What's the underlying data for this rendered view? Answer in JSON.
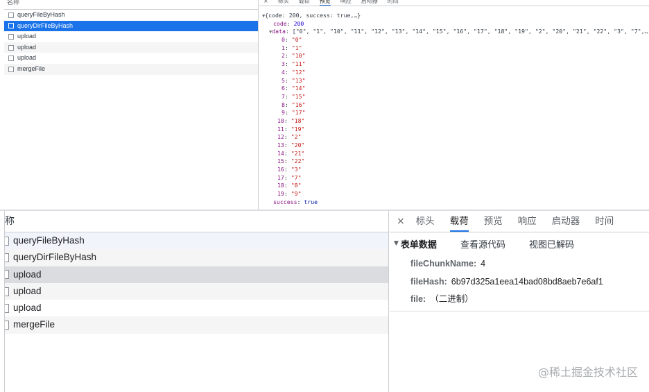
{
  "top": {
    "list_header": "名称",
    "requests": [
      {
        "name": "queryFileByHash",
        "selected": false
      },
      {
        "name": "queryDirFileByHash",
        "selected": true
      },
      {
        "name": "upload",
        "selected": false
      },
      {
        "name": "upload",
        "selected": false
      },
      {
        "name": "upload",
        "selected": false
      },
      {
        "name": "mergeFile",
        "selected": false
      }
    ],
    "tabs": [
      "×",
      "标头",
      "载荷",
      "预览",
      "响应",
      "启动器",
      "时间"
    ],
    "active_tab_index": 3,
    "preview": {
      "summary": "{code: 200, success: true,…}",
      "code_key": "code",
      "code_value": "200",
      "data_key": "data",
      "data_summary": "[\"0\", \"1\", \"10\", \"11\", \"12\", \"13\", \"14\", \"15\", \"16\", \"17\", \"18\", \"19\", \"2\", \"20\", \"21\", \"22\", \"3\", \"7\",…]",
      "data_items": [
        {
          "i": "0",
          "v": "\"0\""
        },
        {
          "i": "1",
          "v": "\"1\""
        },
        {
          "i": "2",
          "v": "\"10\""
        },
        {
          "i": "3",
          "v": "\"11\""
        },
        {
          "i": "4",
          "v": "\"12\""
        },
        {
          "i": "5",
          "v": "\"13\""
        },
        {
          "i": "6",
          "v": "\"14\""
        },
        {
          "i": "7",
          "v": "\"15\""
        },
        {
          "i": "8",
          "v": "\"16\""
        },
        {
          "i": "9",
          "v": "\"17\""
        },
        {
          "i": "10",
          "v": "\"18\""
        },
        {
          "i": "11",
          "v": "\"19\""
        },
        {
          "i": "12",
          "v": "\"2\""
        },
        {
          "i": "13",
          "v": "\"20\""
        },
        {
          "i": "14",
          "v": "\"21\""
        },
        {
          "i": "15",
          "v": "\"22\""
        },
        {
          "i": "16",
          "v": "\"3\""
        },
        {
          "i": "17",
          "v": "\"7\""
        },
        {
          "i": "18",
          "v": "\"8\""
        },
        {
          "i": "19",
          "v": "\"9\""
        }
      ],
      "success_key": "success",
      "success_value": "true"
    }
  },
  "bottom": {
    "list_header": "称",
    "requests": [
      {
        "name": "queryFileByHash"
      },
      {
        "name": "queryDirFileByHash"
      },
      {
        "name": "upload"
      },
      {
        "name": "upload"
      },
      {
        "name": "upload"
      },
      {
        "name": "mergeFile"
      }
    ],
    "selected_index": 2,
    "close_label": "×",
    "tabs": [
      "标头",
      "载荷",
      "预览",
      "响应",
      "启动器",
      "时间"
    ],
    "active_tab_index": 1,
    "form": {
      "title": "表单数据",
      "view_source": "查看源代码",
      "view_decoded": "视图已解码",
      "fields": [
        {
          "key": "fileChunkName:",
          "value": "4"
        },
        {
          "key": "fileHash:",
          "value": "6b97d325a1eea14bad08bd8aeb7e6af1"
        },
        {
          "key": "file:",
          "value": "（二进制）"
        }
      ]
    }
  },
  "watermark": "@稀土掘金技术社区",
  "colors": {
    "selection_blue": "#1a73e8",
    "json_key": "#881280",
    "json_string": "#c41a16",
    "json_number": "#1c00cf"
  }
}
